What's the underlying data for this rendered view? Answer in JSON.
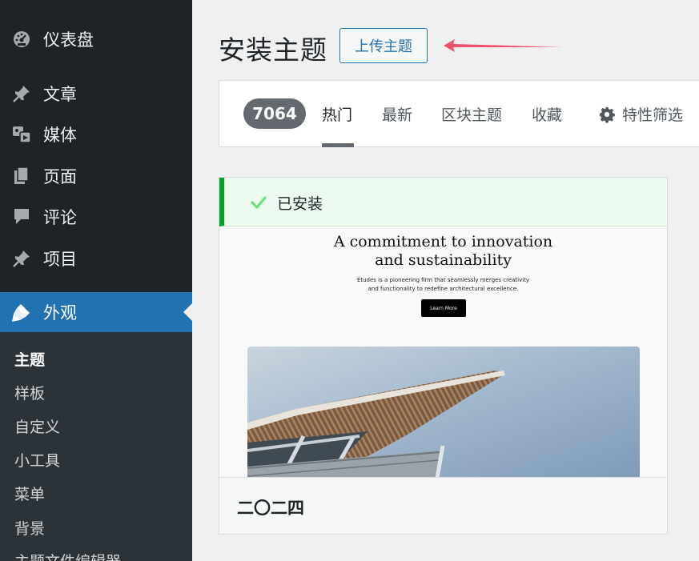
{
  "sidebar": {
    "items": [
      {
        "key": "dashboard",
        "label": "仪表盘",
        "icon": "dashboard-icon"
      },
      {
        "key": "posts",
        "label": "文章",
        "icon": "pin-icon"
      },
      {
        "key": "media",
        "label": "媒体",
        "icon": "media-icon"
      },
      {
        "key": "pages",
        "label": "页面",
        "icon": "pages-icon"
      },
      {
        "key": "comments",
        "label": "评论",
        "icon": "comment-icon"
      },
      {
        "key": "projects",
        "label": "项目",
        "icon": "pin-icon"
      },
      {
        "key": "appearance",
        "label": "外观",
        "icon": "paintbrush-icon"
      }
    ],
    "submenu": [
      {
        "label": "主题",
        "current": true
      },
      {
        "label": "样板"
      },
      {
        "label": "自定义"
      },
      {
        "label": "小工具"
      },
      {
        "label": "菜单"
      },
      {
        "label": "背景"
      },
      {
        "label": "主题文件编辑器"
      }
    ],
    "active_color": "#2271b1",
    "background": "#1d2327"
  },
  "header": {
    "title": "安装主题",
    "upload_button": "上传主题",
    "annotation_arrow_color": "#f0506e"
  },
  "filters": {
    "count": "7064",
    "tabs": [
      {
        "label": "热门",
        "current": true
      },
      {
        "label": "最新"
      },
      {
        "label": "区块主题"
      },
      {
        "label": "收藏"
      }
    ],
    "feature_filter": "特性筛选",
    "feature_filter_icon": "gear-icon"
  },
  "theme": {
    "installed_label": "已安装",
    "installed_color": "#00a32a",
    "preview": {
      "headline_line1": "A commitment to innovation",
      "headline_line2": "and sustainability",
      "body_line1": "Études is a pioneering firm that seamlessly merges creativity",
      "body_line2": "and functionality to redefine architectural excellence.",
      "button": "Learn More"
    },
    "name": "二〇二四"
  }
}
